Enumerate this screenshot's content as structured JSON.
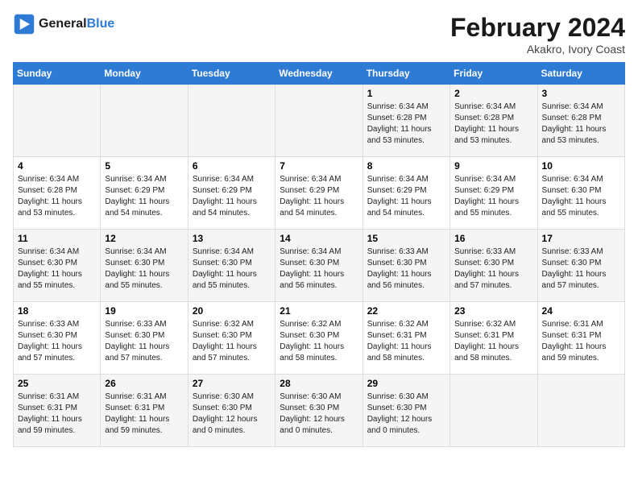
{
  "header": {
    "logo_line1": "General",
    "logo_line2": "Blue",
    "main_title": "February 2024",
    "subtitle": "Akakro, Ivory Coast"
  },
  "days_of_week": [
    "Sunday",
    "Monday",
    "Tuesday",
    "Wednesday",
    "Thursday",
    "Friday",
    "Saturday"
  ],
  "weeks": [
    [
      {
        "day": "",
        "info": ""
      },
      {
        "day": "",
        "info": ""
      },
      {
        "day": "",
        "info": ""
      },
      {
        "day": "",
        "info": ""
      },
      {
        "day": "1",
        "info": "Sunrise: 6:34 AM\nSunset: 6:28 PM\nDaylight: 11 hours\nand 53 minutes."
      },
      {
        "day": "2",
        "info": "Sunrise: 6:34 AM\nSunset: 6:28 PM\nDaylight: 11 hours\nand 53 minutes."
      },
      {
        "day": "3",
        "info": "Sunrise: 6:34 AM\nSunset: 6:28 PM\nDaylight: 11 hours\nand 53 minutes."
      }
    ],
    [
      {
        "day": "4",
        "info": "Sunrise: 6:34 AM\nSunset: 6:28 PM\nDaylight: 11 hours\nand 53 minutes."
      },
      {
        "day": "5",
        "info": "Sunrise: 6:34 AM\nSunset: 6:29 PM\nDaylight: 11 hours\nand 54 minutes."
      },
      {
        "day": "6",
        "info": "Sunrise: 6:34 AM\nSunset: 6:29 PM\nDaylight: 11 hours\nand 54 minutes."
      },
      {
        "day": "7",
        "info": "Sunrise: 6:34 AM\nSunset: 6:29 PM\nDaylight: 11 hours\nand 54 minutes."
      },
      {
        "day": "8",
        "info": "Sunrise: 6:34 AM\nSunset: 6:29 PM\nDaylight: 11 hours\nand 54 minutes."
      },
      {
        "day": "9",
        "info": "Sunrise: 6:34 AM\nSunset: 6:29 PM\nDaylight: 11 hours\nand 55 minutes."
      },
      {
        "day": "10",
        "info": "Sunrise: 6:34 AM\nSunset: 6:30 PM\nDaylight: 11 hours\nand 55 minutes."
      }
    ],
    [
      {
        "day": "11",
        "info": "Sunrise: 6:34 AM\nSunset: 6:30 PM\nDaylight: 11 hours\nand 55 minutes."
      },
      {
        "day": "12",
        "info": "Sunrise: 6:34 AM\nSunset: 6:30 PM\nDaylight: 11 hours\nand 55 minutes."
      },
      {
        "day": "13",
        "info": "Sunrise: 6:34 AM\nSunset: 6:30 PM\nDaylight: 11 hours\nand 55 minutes."
      },
      {
        "day": "14",
        "info": "Sunrise: 6:34 AM\nSunset: 6:30 PM\nDaylight: 11 hours\nand 56 minutes."
      },
      {
        "day": "15",
        "info": "Sunrise: 6:33 AM\nSunset: 6:30 PM\nDaylight: 11 hours\nand 56 minutes."
      },
      {
        "day": "16",
        "info": "Sunrise: 6:33 AM\nSunset: 6:30 PM\nDaylight: 11 hours\nand 57 minutes."
      },
      {
        "day": "17",
        "info": "Sunrise: 6:33 AM\nSunset: 6:30 PM\nDaylight: 11 hours\nand 57 minutes."
      }
    ],
    [
      {
        "day": "18",
        "info": "Sunrise: 6:33 AM\nSunset: 6:30 PM\nDaylight: 11 hours\nand 57 minutes."
      },
      {
        "day": "19",
        "info": "Sunrise: 6:33 AM\nSunset: 6:30 PM\nDaylight: 11 hours\nand 57 minutes."
      },
      {
        "day": "20",
        "info": "Sunrise: 6:32 AM\nSunset: 6:30 PM\nDaylight: 11 hours\nand 57 minutes."
      },
      {
        "day": "21",
        "info": "Sunrise: 6:32 AM\nSunset: 6:30 PM\nDaylight: 11 hours\nand 58 minutes."
      },
      {
        "day": "22",
        "info": "Sunrise: 6:32 AM\nSunset: 6:31 PM\nDaylight: 11 hours\nand 58 minutes."
      },
      {
        "day": "23",
        "info": "Sunrise: 6:32 AM\nSunset: 6:31 PM\nDaylight: 11 hours\nand 58 minutes."
      },
      {
        "day": "24",
        "info": "Sunrise: 6:31 AM\nSunset: 6:31 PM\nDaylight: 11 hours\nand 59 minutes."
      }
    ],
    [
      {
        "day": "25",
        "info": "Sunrise: 6:31 AM\nSunset: 6:31 PM\nDaylight: 11 hours\nand 59 minutes."
      },
      {
        "day": "26",
        "info": "Sunrise: 6:31 AM\nSunset: 6:31 PM\nDaylight: 11 hours\nand 59 minutes."
      },
      {
        "day": "27",
        "info": "Sunrise: 6:30 AM\nSunset: 6:30 PM\nDaylight: 12 hours\nand 0 minutes."
      },
      {
        "day": "28",
        "info": "Sunrise: 6:30 AM\nSunset: 6:30 PM\nDaylight: 12 hours\nand 0 minutes."
      },
      {
        "day": "29",
        "info": "Sunrise: 6:30 AM\nSunset: 6:30 PM\nDaylight: 12 hours\nand 0 minutes."
      },
      {
        "day": "",
        "info": ""
      },
      {
        "day": "",
        "info": ""
      }
    ]
  ]
}
